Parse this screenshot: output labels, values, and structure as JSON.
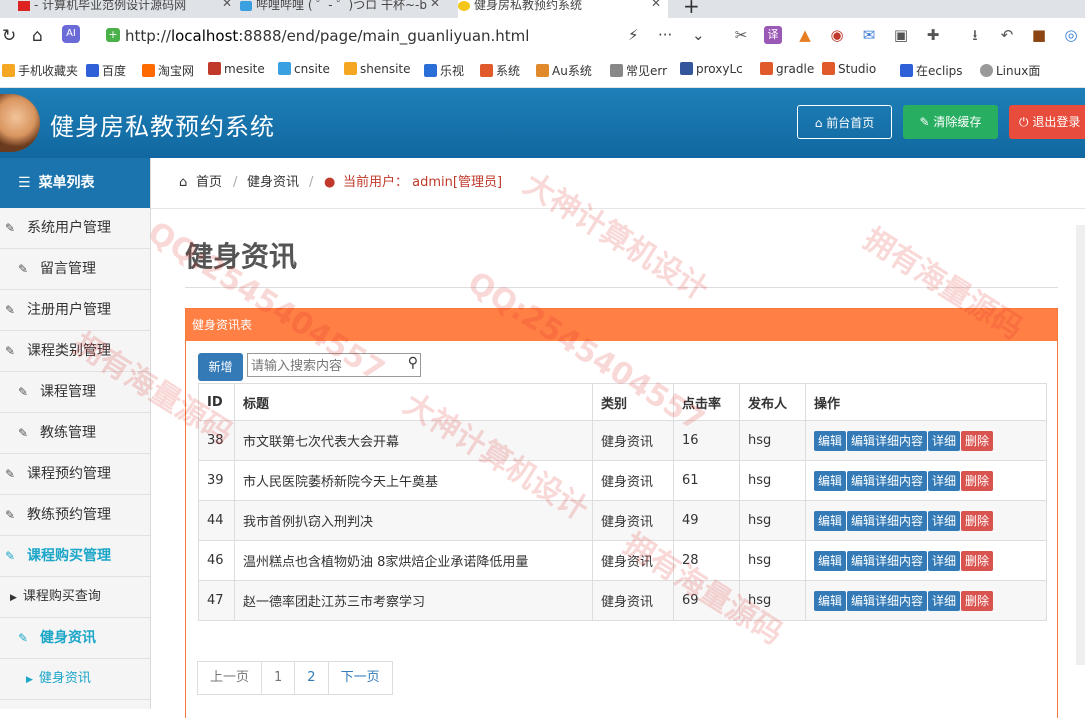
{
  "browser": {
    "tabs": [
      {
        "label": "- 计算机毕业范例设计源码网"
      },
      {
        "label": "哔哩哔哩 ( ゜- ゜)つロ 干杯~-b"
      },
      {
        "label": "健身房私教预约系统"
      }
    ],
    "url_prefix": "http://",
    "url_host": "localhost",
    "url_rest": ":8888/end/page/main_guanliyuan.html",
    "bookmarks": [
      {
        "label": "手机收藏夹",
        "color": "#f5a623"
      },
      {
        "label": "百度",
        "color": "#3060d8"
      },
      {
        "label": "淘宝网",
        "color": "#ff6a00"
      },
      {
        "label": "mesite",
        "color": "#c0392b"
      },
      {
        "label": "cnsite",
        "color": "#3aa0e0"
      },
      {
        "label": "shensite",
        "color": "#f5a623"
      },
      {
        "label": "乐视",
        "color": "#2a6fd8"
      },
      {
        "label": "系统",
        "color": "#e05a2b"
      },
      {
        "label": "Au系统",
        "color": "#e08a2b"
      },
      {
        "label": "常见err",
        "color": "#888888"
      },
      {
        "label": "proxyLc",
        "color": "#335599"
      },
      {
        "label": "gradle",
        "color": "#e05a2b"
      },
      {
        "label": "Studio",
        "color": "#e05a2b"
      },
      {
        "label": "在eclips",
        "color": "#3060d8"
      },
      {
        "label": "Linux面",
        "color": "#999999"
      }
    ]
  },
  "header": {
    "title": "健身房私教预约系统",
    "home_label": "前台首页",
    "clear_cache_label": "清除缓存",
    "logout_label": "退出登录"
  },
  "sidebar": {
    "title": "菜单列表",
    "items": [
      {
        "label": "系统用户管理"
      },
      {
        "label": "留言管理"
      },
      {
        "label": "注册用户管理"
      },
      {
        "label": "课程类别管理"
      },
      {
        "label": "课程管理"
      },
      {
        "label": "教练管理"
      },
      {
        "label": "课程预约管理"
      },
      {
        "label": "教练预约管理"
      },
      {
        "label": "课程购买管理"
      },
      {
        "label": "课程购买查询"
      },
      {
        "label": "健身资讯"
      },
      {
        "label": "健身资讯"
      }
    ]
  },
  "breadcrumb": {
    "home": "首页",
    "section": "健身资讯",
    "user_prefix": "当前用户：",
    "user": "admin[管理员]"
  },
  "main": {
    "page_title": "健身资讯",
    "panel_title": "健身资讯表",
    "new_button": "新增",
    "search_placeholder": "请输入搜索内容",
    "columns": [
      "ID",
      "标题",
      "类别",
      "点击率",
      "发布人",
      "操作"
    ],
    "rows": [
      {
        "id": "38",
        "title": "市文联第七次代表大会开幕",
        "category": "健身资讯",
        "clicks": "16",
        "publisher": "hsg"
      },
      {
        "id": "39",
        "title": "市人民医院萎桥新院今天上午奠基",
        "category": "健身资讯",
        "clicks": "61",
        "publisher": "hsg"
      },
      {
        "id": "44",
        "title": "我市首例扒窃入刑判决",
        "category": "健身资讯",
        "clicks": "49",
        "publisher": "hsg"
      },
      {
        "id": "46",
        "title": "温州糕点也含植物奶油 8家烘焙企业承诺降低用量",
        "category": "健身资讯",
        "clicks": "28",
        "publisher": "hsg"
      },
      {
        "id": "47",
        "title": "赵一德率团赴江苏三市考察学习",
        "category": "健身资讯",
        "clicks": "69",
        "publisher": "hsg"
      }
    ],
    "row_actions": {
      "edit": "编辑",
      "edit_detail": "编辑详细内容",
      "detail": "详细",
      "delete": "删除"
    },
    "pager": {
      "prev": "上一页",
      "pages": [
        "1",
        "2"
      ],
      "next": "下一页"
    }
  },
  "watermark": {
    "lines": [
      "QQ:2545404557",
      "大神计算机设计",
      "拥有海量源码"
    ]
  }
}
